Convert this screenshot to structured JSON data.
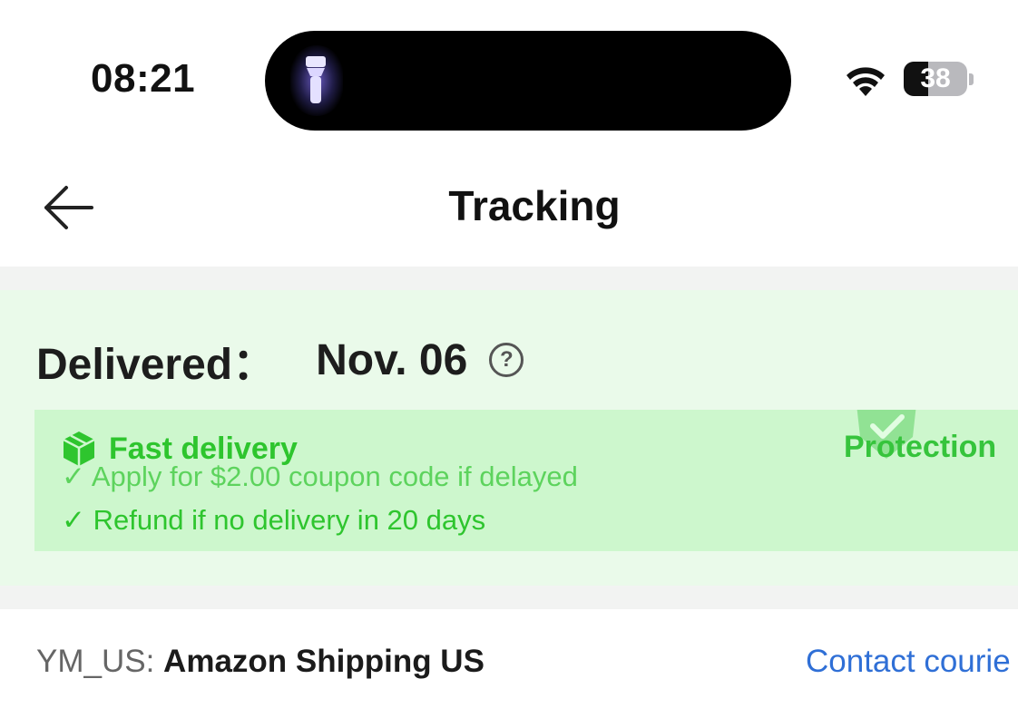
{
  "status_bar": {
    "time": "08:21",
    "battery_level": "38",
    "battery_fraction": 0.38,
    "icons": [
      "flashlight-icon",
      "wifi-icon",
      "battery-icon"
    ]
  },
  "nav": {
    "back_icon": "arrow-left-icon",
    "title": "Tracking"
  },
  "delivery": {
    "status_label": "Delivered：",
    "date": "Nov. 06",
    "help_symbol": "?",
    "fast_delivery_label": "Fast delivery",
    "protection_label": "Protection",
    "benefits": [
      "✓ Apply for $2.00 coupon code if delayed",
      "✓ Refund if no delivery in 20 days"
    ]
  },
  "carrier": {
    "prefix": "YM_US: ",
    "name": "Amazon Shipping US",
    "contact_label": "Contact courie"
  },
  "colors": {
    "accent_green": "#2ec52e",
    "card_background": "#eafaea",
    "box_background": "#cdf7cd",
    "link_blue": "#2f6fd6"
  }
}
